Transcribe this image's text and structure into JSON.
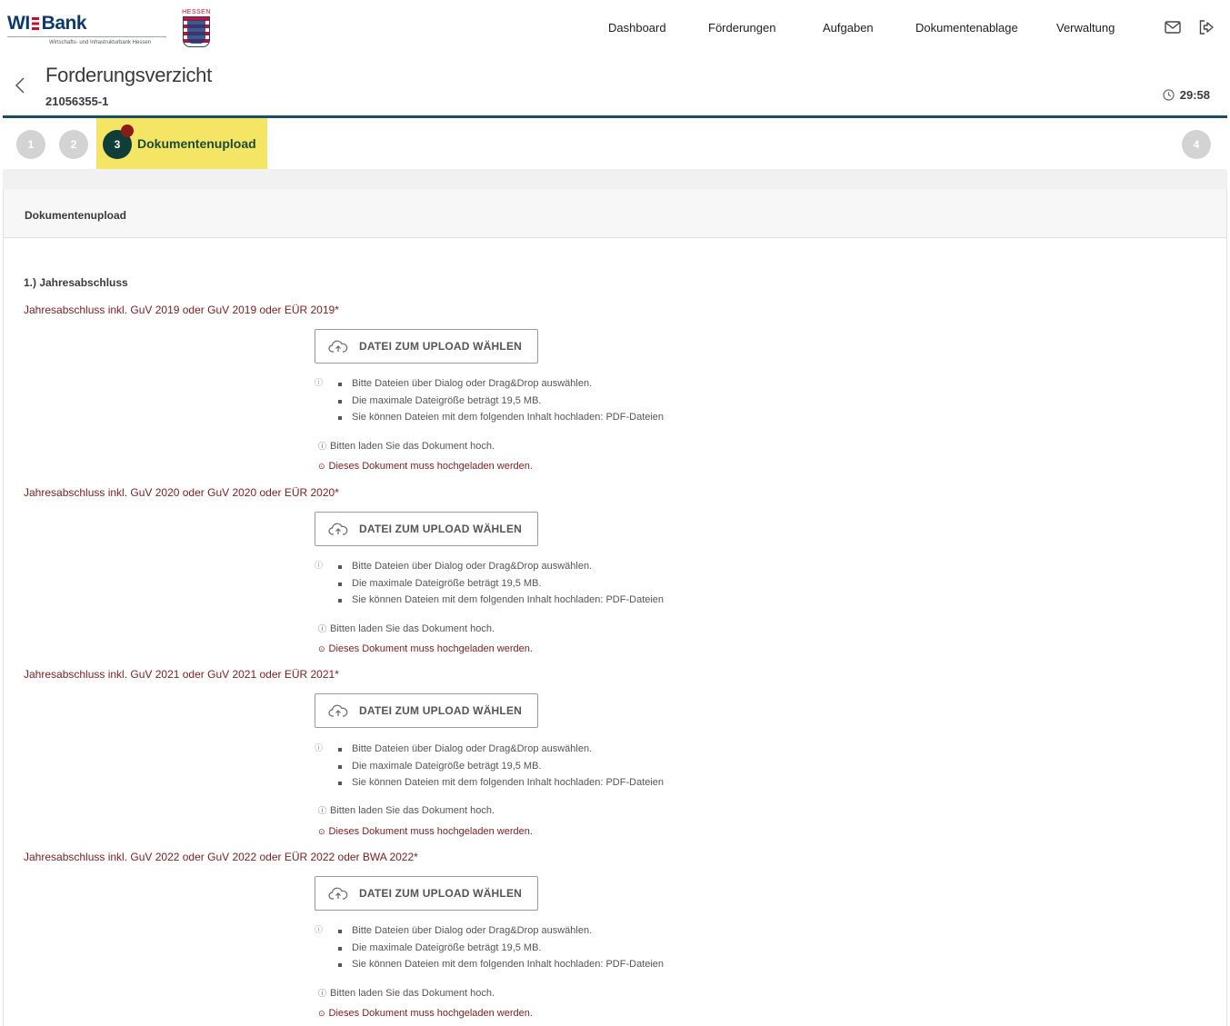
{
  "header": {
    "logo_text": "WI Bank",
    "logo_sub": "Wirtschafts- und Infrastrukturbank Hessen",
    "state_label": "HESSEN",
    "nav": [
      "Dashboard",
      "Förderungen",
      "Aufgaben",
      "Dokumentenablage",
      "Verwaltung"
    ]
  },
  "page": {
    "title": "Forderungsverzicht",
    "reference": "21056355-1",
    "timer": "29:58"
  },
  "stepper": {
    "steps": [
      "1",
      "2",
      "3",
      "4"
    ],
    "active_label": "Dokumentenupload"
  },
  "card": {
    "title": "Dokumentenupload",
    "section_title": "1.) Jahresabschluss"
  },
  "documents": [
    {
      "label": "Jahresabschluss inkl. GuV 2019 oder GuV 2019 oder EÜR 2019*",
      "button": "DATEI ZUM UPLOAD WÄHLEN",
      "hints": [
        "Bitte Dateien über Dialog oder Drag&Drop auswählen.",
        "Die maximale Dateigröße beträgt 19,5 MB.",
        "Sie können Dateien mit dem folgenden Inhalt hochladen: PDF-Dateien"
      ],
      "info": "Bitten laden Sie das Dokument hoch.",
      "required": "Dieses Dokument muss hochgeladen werden."
    },
    {
      "label": "Jahresabschluss inkl. GuV 2020 oder GuV 2020 oder EÜR 2020*",
      "button": "DATEI ZUM UPLOAD WÄHLEN",
      "hints": [
        "Bitte Dateien über Dialog oder Drag&Drop auswählen.",
        "Die maximale Dateigröße beträgt 19,5 MB.",
        "Sie können Dateien mit dem folgenden Inhalt hochladen: PDF-Dateien"
      ],
      "info": "Bitten laden Sie das Dokument hoch.",
      "required": "Dieses Dokument muss hochgeladen werden."
    },
    {
      "label": "Jahresabschluss inkl. GuV 2021 oder GuV 2021 oder EÜR 2021*",
      "button": "DATEI ZUM UPLOAD WÄHLEN",
      "hints": [
        "Bitte Dateien über Dialog oder Drag&Drop auswählen.",
        "Die maximale Dateigröße beträgt 19,5 MB.",
        "Sie können Dateien mit dem folgenden Inhalt hochladen: PDF-Dateien"
      ],
      "info": "Bitten laden Sie das Dokument hoch.",
      "required": "Dieses Dokument muss hochgeladen werden."
    },
    {
      "label": "Jahresabschluss inkl. GuV 2022 oder GuV 2022 oder EÜR 2022 oder BWA 2022*",
      "button": "DATEI ZUM UPLOAD WÄHLEN",
      "hints": [
        "Bitte Dateien über Dialog oder Drag&Drop auswählen.",
        "Die maximale Dateigröße beträgt 19,5 MB.",
        "Sie können Dateien mit dem folgenden Inhalt hochladen: PDF-Dateien"
      ],
      "info": "Bitten laden Sie das Dokument hoch.",
      "required": "Dieses Dokument muss hochgeladen werden."
    }
  ],
  "colors": {
    "brand_blue": "#0e3a6b",
    "header_divider": "#1c4e63",
    "active_step_bg": "#f4e565",
    "active_step_circle": "#0f3d37",
    "required_text": "#7a1e1e"
  }
}
